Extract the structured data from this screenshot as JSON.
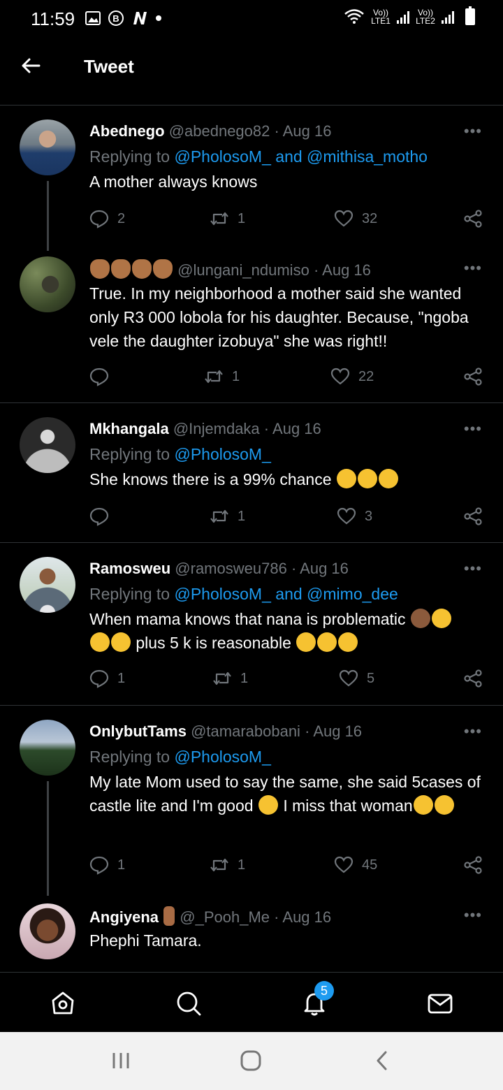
{
  "status_bar": {
    "time": "11:59",
    "lte1": "Vo)) LTE1",
    "lte2": "Vo)) LTE2",
    "left_icons": [
      "image-icon",
      "b-icon",
      "n-icon",
      "dot-icon"
    ]
  },
  "header": {
    "title": "Tweet"
  },
  "tweets": [
    {
      "name": "Abednego",
      "handle": "@abednego82",
      "dot": "·",
      "date": "Aug 16",
      "replying_prefix": "Replying to ",
      "replying_1": "@PholosoM_",
      "replying_and": " and ",
      "replying_2": "@mithisa_motho",
      "text": "A mother always knows",
      "replies": "2",
      "retweets": "1",
      "likes": "32"
    },
    {
      "name": "",
      "handle": "@lungani_ndumiso",
      "dot": "·",
      "date": "Aug 16",
      "text": "True. In my neighborhood a mother said she wanted only R3 000 lobola for his daughter. Because, \"ngoba vele the daughter izobuya\" she was right!!",
      "replies": "",
      "retweets": "1",
      "likes": "22"
    },
    {
      "name": "Mkhangala",
      "handle": "@Injemdaka",
      "dot": "·",
      "date": "Aug 16",
      "replying_prefix": "Replying to ",
      "replying_1": "@PholosoM_",
      "text": "She knows there is a 99% chance",
      "replies": "",
      "retweets": "1",
      "likes": "3"
    },
    {
      "name": "Ramosweu",
      "handle": "@ramosweu786",
      "dot": "·",
      "date": "Aug 16",
      "replying_prefix": "Replying to ",
      "replying_1": "@PholosoM_",
      "replying_and": " and ",
      "replying_2": "@mimo_dee",
      "text_1": "When mama knows that nana is problematic",
      "text_2": "plus 5 k is reasonable",
      "replies": "1",
      "retweets": "1",
      "likes": "5"
    },
    {
      "name": "OnlybutTams",
      "handle": "@tamarabobani",
      "dot": "·",
      "date": "Aug 16",
      "replying_prefix": "Replying to ",
      "replying_1": "@PholosoM_",
      "text_1": "My late Mom used to say the same, she said 5cases of castle lite and I'm good",
      "text_2": "I miss that woman",
      "replies": "1",
      "retweets": "1",
      "likes": "45"
    },
    {
      "name": "Angiyena",
      "handle": "@_Pooh_Me",
      "dot": "·",
      "date": "Aug 16",
      "text": "Phephi Tamara."
    }
  ],
  "more_label": "•••",
  "nav": {
    "notifications_count": "5",
    "items": [
      "home-icon",
      "search-icon",
      "notifications-icon",
      "messages-icon"
    ]
  },
  "colors": {
    "background": "#000000",
    "accent": "#1d9bf0",
    "muted": "#71767b",
    "divider": "#2f3336"
  }
}
